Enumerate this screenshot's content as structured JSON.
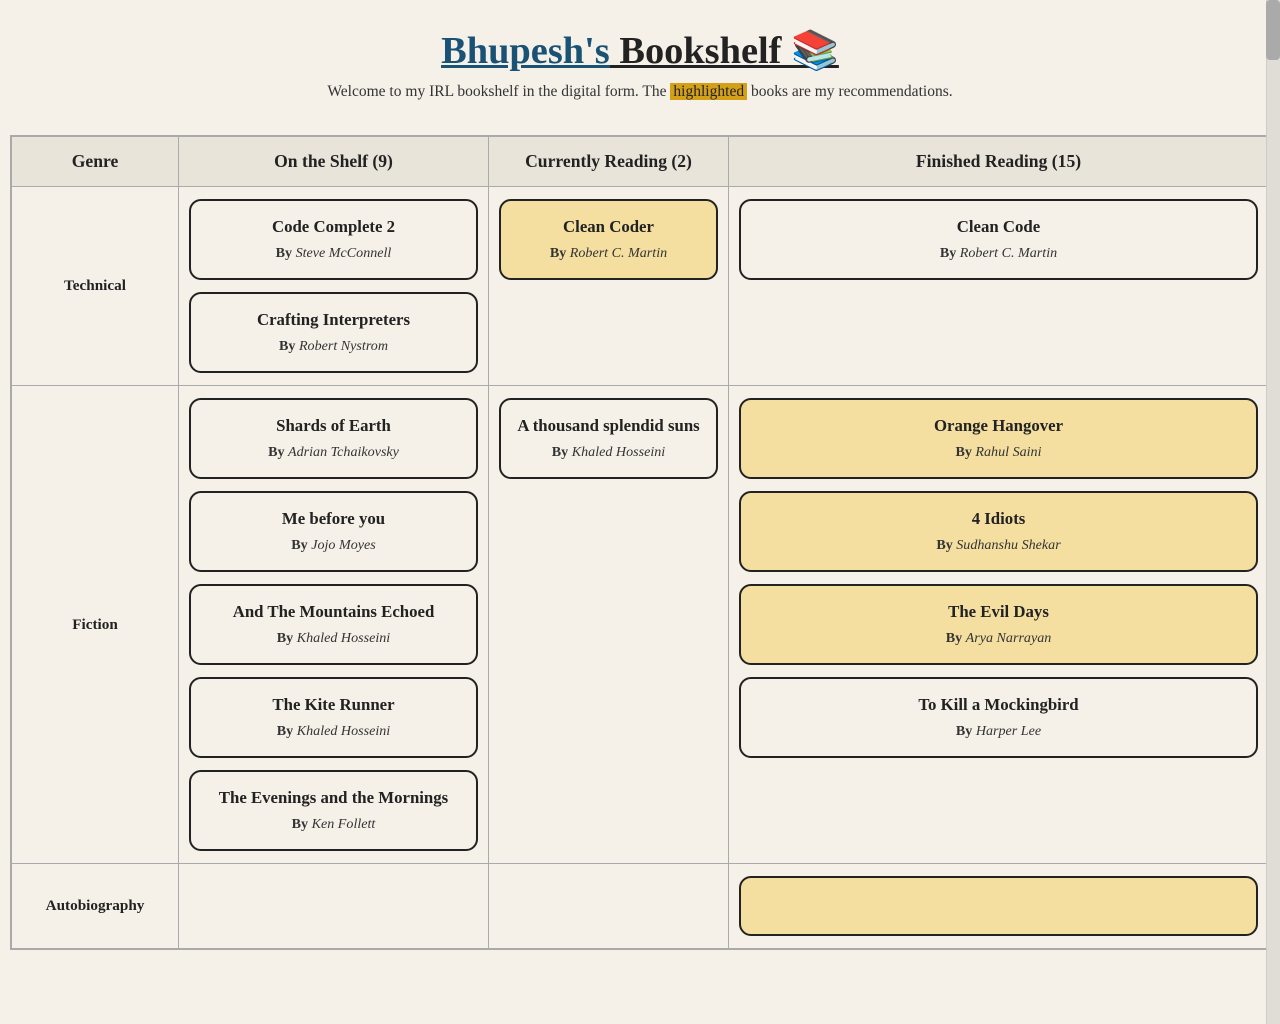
{
  "header": {
    "title_link": "Bhupesh's",
    "title_rest": " Bookshelf 📚",
    "subtitle_before": "Welcome to my IRL bookshelf in the digital form. The ",
    "subtitle_highlight": "highlighted",
    "subtitle_after": " books are my recommendations."
  },
  "table": {
    "col_genre": "Genre",
    "col_shelf": "On the Shelf (9)",
    "col_current": "Currently Reading (2)",
    "col_finished": "Finished Reading (15)"
  },
  "rows": [
    {
      "genre": "Technical",
      "shelf": [
        {
          "title": "Code Complete 2",
          "author": "Steve McConnell",
          "highlighted": false
        },
        {
          "title": "Crafting Interpreters",
          "author": "Robert Nystrom",
          "highlighted": false
        }
      ],
      "current": [
        {
          "title": "Clean Coder",
          "author": "Robert C. Martin",
          "highlighted": true
        }
      ],
      "finished": [
        {
          "title": "Clean Code",
          "author": "Robert C. Martin",
          "highlighted": false
        }
      ]
    },
    {
      "genre": "Fiction",
      "shelf": [
        {
          "title": "Shards of Earth",
          "author": "Adrian Tchaikovsky",
          "highlighted": false
        },
        {
          "title": "Me before you",
          "author": "Jojo Moyes",
          "highlighted": false
        },
        {
          "title": "And The Mountains Echoed",
          "author": "Khaled Hosseini",
          "highlighted": false
        },
        {
          "title": "The Kite Runner",
          "author": "Khaled Hosseini",
          "highlighted": false
        },
        {
          "title": "The Evenings and the Mornings",
          "author": "Ken Follett",
          "highlighted": false
        }
      ],
      "current": [
        {
          "title": "A thousand splendid suns",
          "author": "Khaled Hosseini",
          "highlighted": false
        }
      ],
      "finished": [
        {
          "title": "Orange Hangover",
          "author": "Rahul Saini",
          "highlighted": true
        },
        {
          "title": "4 Idiots",
          "author": "Sudhanshu Shekar",
          "highlighted": true
        },
        {
          "title": "The Evil Days",
          "author": "Arya Narrayan",
          "highlighted": true
        },
        {
          "title": "To Kill a Mockingbird",
          "author": "Harper Lee",
          "highlighted": false
        }
      ]
    },
    {
      "genre": "Autobiography",
      "shelf": [],
      "current": [],
      "finished": [
        {
          "title": "",
          "author": "",
          "highlighted": true
        }
      ]
    }
  ]
}
